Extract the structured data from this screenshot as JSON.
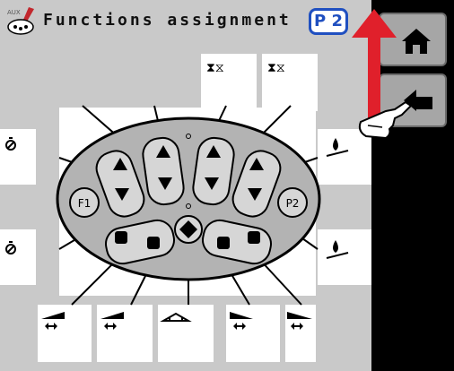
{
  "header": {
    "logo_text": "AUX",
    "title": "Functions assignment",
    "page_badge": "P 2"
  },
  "remote": {
    "left_round_label": "F1",
    "right_round_label": "P2"
  },
  "side_buttons": [
    {
      "name": "home",
      "icon": "home-icon"
    },
    {
      "name": "back",
      "icon": "back-arrow-icon"
    }
  ],
  "colors": {
    "badge": "#1f4fc0",
    "arrow": "#e0202b",
    "screen_bg": "#c9c9c9"
  }
}
